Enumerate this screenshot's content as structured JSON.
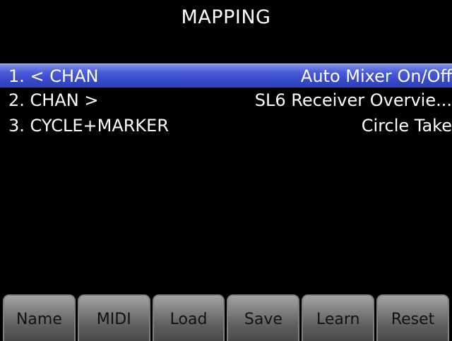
{
  "header": {
    "title": "MAPPING"
  },
  "mappings": [
    {
      "function": "1. < CHAN",
      "target": "Auto Mixer On/Off",
      "selected": true
    },
    {
      "function": "2. CHAN >",
      "target": "SL6 Receiver Overvie...",
      "selected": false
    },
    {
      "function": "3. CYCLE+MARKER",
      "target": "Circle Take",
      "selected": false
    }
  ],
  "softkeys": [
    {
      "label": "Name"
    },
    {
      "label": "MIDI"
    },
    {
      "label": "Load"
    },
    {
      "label": "Save"
    },
    {
      "label": "Learn"
    },
    {
      "label": "Reset"
    }
  ],
  "colors": {
    "background": "#000000",
    "text": "#ffffff",
    "selection": "#3548c9",
    "softkey": "#868686",
    "softkey_text": "#111111"
  }
}
